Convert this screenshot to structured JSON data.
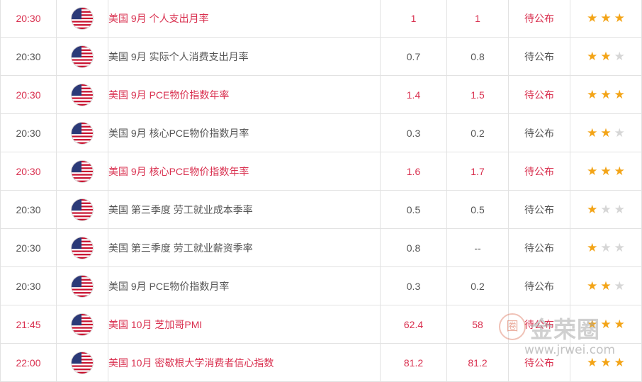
{
  "calendar": {
    "rows": [
      {
        "time": "20:30",
        "country": "美国",
        "event": "9月 个人支出月率",
        "previous": "1",
        "forecast": "1",
        "actual": "待公布",
        "importance": 3,
        "highlight": true
      },
      {
        "time": "20:30",
        "country": "美国",
        "event": "9月 实际个人消费支出月率",
        "previous": "0.7",
        "forecast": "0.8",
        "actual": "待公布",
        "importance": 2,
        "highlight": false
      },
      {
        "time": "20:30",
        "country": "美国",
        "event": "9月 PCE物价指数年率",
        "previous": "1.4",
        "forecast": "1.5",
        "actual": "待公布",
        "importance": 3,
        "highlight": true
      },
      {
        "time": "20:30",
        "country": "美国",
        "event": "9月 核心PCE物价指数月率",
        "previous": "0.3",
        "forecast": "0.2",
        "actual": "待公布",
        "importance": 2,
        "highlight": false
      },
      {
        "time": "20:30",
        "country": "美国",
        "event": "9月 核心PCE物价指数年率",
        "previous": "1.6",
        "forecast": "1.7",
        "actual": "待公布",
        "importance": 3,
        "highlight": true
      },
      {
        "time": "20:30",
        "country": "美国",
        "event": "第三季度 劳工就业成本季率",
        "previous": "0.5",
        "forecast": "0.5",
        "actual": "待公布",
        "importance": 1,
        "highlight": false
      },
      {
        "time": "20:30",
        "country": "美国",
        "event": "第三季度 劳工就业薪资季率",
        "previous": "0.8",
        "forecast": "--",
        "actual": "待公布",
        "importance": 1,
        "highlight": false
      },
      {
        "time": "20:30",
        "country": "美国",
        "event": "9月 PCE物价指数月率",
        "previous": "0.3",
        "forecast": "0.2",
        "actual": "待公布",
        "importance": 2,
        "highlight": false
      },
      {
        "time": "21:45",
        "country": "美国",
        "event": "10月 芝加哥PMI",
        "previous": "62.4",
        "forecast": "58",
        "actual": "待公布",
        "importance": 3,
        "highlight": true
      },
      {
        "time": "22:00",
        "country": "美国",
        "event": "10月 密歇根大学消费者信心指数",
        "previous": "81.2",
        "forecast": "81.2",
        "actual": "待公布",
        "importance": 3,
        "highlight": true
      }
    ],
    "flag_icon": "us-flag-icon",
    "max_stars": 3
  },
  "watermark": {
    "logo_glyph": "圈",
    "name": "金荣圈",
    "url": "www.jrwei.com"
  },
  "colors": {
    "highlight_text": "#d9304f",
    "normal_text": "#555555",
    "star_on": "#f3a417",
    "star_off": "#d6d6d6",
    "grid": "#e2e2e2"
  }
}
